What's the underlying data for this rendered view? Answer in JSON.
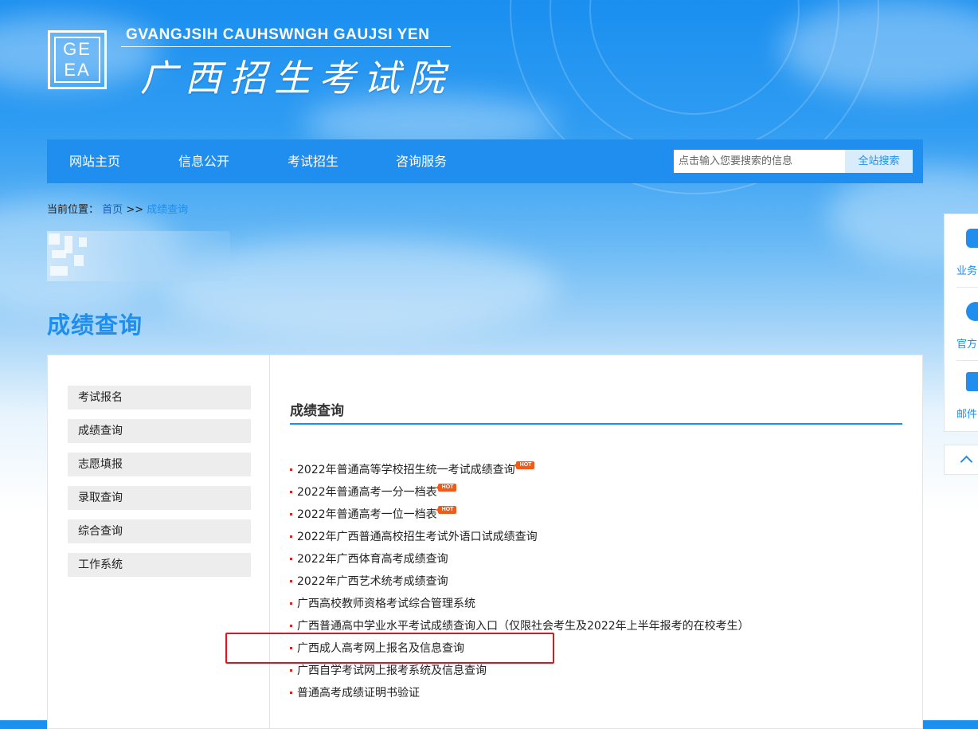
{
  "header": {
    "logo_line1": "GE",
    "logo_line2": "EA",
    "en_title": "GVANGJSIH CAUHSWNGH GAUJSI YEN",
    "cn_title": "广西招生考试院"
  },
  "nav": {
    "items": [
      {
        "label": "网站主页"
      },
      {
        "label": "信息公开"
      },
      {
        "label": "考试招生"
      },
      {
        "label": "咨询服务"
      }
    ],
    "search_placeholder": "点击输入您要搜索的信息",
    "search_button": "全站搜索"
  },
  "breadcrumb": {
    "prefix": "当前位置：",
    "home": "首页",
    "sep": ">>",
    "current": "成绩查询"
  },
  "page_title": "成绩查询",
  "sidebar": {
    "items": [
      {
        "label": "考试报名"
      },
      {
        "label": "成绩查询"
      },
      {
        "label": "志愿填报"
      },
      {
        "label": "录取查询"
      },
      {
        "label": "综合查询"
      },
      {
        "label": "工作系统"
      }
    ]
  },
  "section": {
    "title": "成绩查询",
    "hot_label": "HOT",
    "links": [
      {
        "text": "2022年普通高等学校招生统一考试成绩查询",
        "hot": true
      },
      {
        "text": "2022年普通高考一分一档表",
        "hot": true
      },
      {
        "text": "2022年普通高考一位一档表",
        "hot": true
      },
      {
        "text": "2022年广西普通高校招生考试外语口试成绩查询",
        "hot": false
      },
      {
        "text": "2022年广西体育高考成绩查询",
        "hot": false
      },
      {
        "text": "2022年广西艺术统考成绩查询",
        "hot": false
      },
      {
        "text": "广西高校教师资格考试综合管理系统",
        "hot": false
      },
      {
        "text": "广西普通高中学业水平考试成绩查询入口（仅限社会考生及2022年上半年报考的在校考生）",
        "hot": false
      },
      {
        "text": "广西成人高考网上报名及信息查询",
        "hot": false
      },
      {
        "text": "广西自学考试网上报考系统及信息查询",
        "hot": false
      },
      {
        "text": "普通高考成绩证明书验证",
        "hot": false
      }
    ]
  },
  "float_bar": {
    "items": [
      {
        "label": "业务"
      },
      {
        "label": "官方"
      },
      {
        "label": "邮件"
      }
    ]
  },
  "colors": {
    "accent": "#1f8eee",
    "highlight": "#e8121a",
    "hot": "#f05a1a"
  }
}
